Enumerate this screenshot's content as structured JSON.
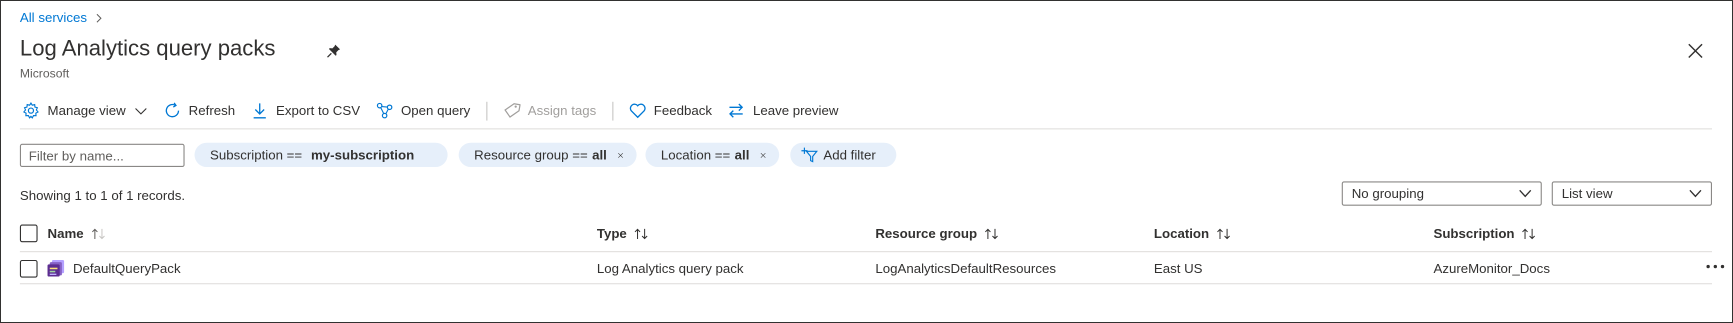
{
  "breadcrumb": {
    "label": "All services"
  },
  "header": {
    "title": "Log Analytics query packs",
    "subtitle": "Microsoft"
  },
  "toolbar": {
    "manage_view": "Manage view",
    "refresh": "Refresh",
    "export_csv": "Export to CSV",
    "open_query": "Open query",
    "assign_tags": "Assign tags",
    "feedback": "Feedback",
    "leave_preview": "Leave preview"
  },
  "filters": {
    "name_placeholder": "Filter by name...",
    "subscription_label": "Subscription ==",
    "subscription_value": "my-subscription",
    "resource_group_label": "Resource group ==",
    "resource_group_value": "all",
    "location_label": "Location ==",
    "location_value": "all",
    "add_filter": "Add filter"
  },
  "records": "Showing 1 to 1 of 1 records.",
  "grouping": {
    "selected": "No grouping"
  },
  "view": {
    "selected": "List view"
  },
  "table": {
    "columns": [
      "Name",
      "Type",
      "Resource group",
      "Location",
      "Subscription"
    ],
    "rows": [
      {
        "name": "DefaultQueryPack",
        "type": "Log Analytics query pack",
        "resource_group": "LogAnalyticsDefaultResources",
        "location": "East US",
        "subscription": "AzureMonitor_Docs"
      }
    ]
  },
  "colors": {
    "link": "#0078d4",
    "pill_bg": "#e6effa",
    "text": "#323130",
    "icon_purple": "#8661c5"
  }
}
